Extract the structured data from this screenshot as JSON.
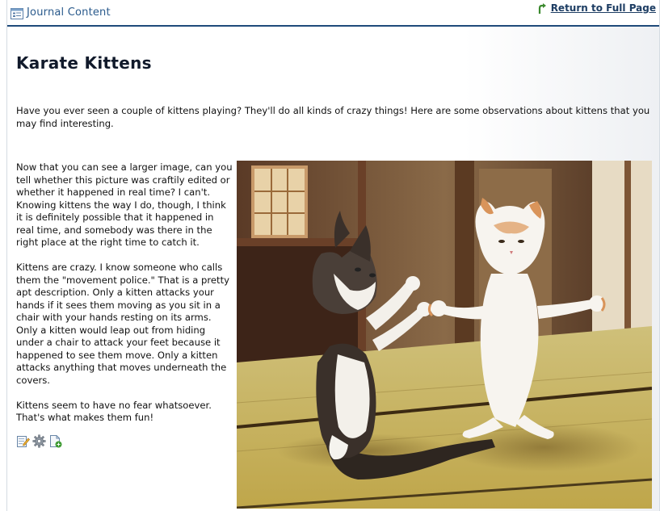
{
  "portlet": {
    "title": "Journal Content",
    "return_link": "Return to Full Page"
  },
  "article": {
    "title": "Karate Kittens",
    "intro": "Have you ever seen a couple of kittens playing? They'll do all kinds of crazy things! Here are some observations about kittens that you may find interesting.",
    "paragraphs": [
      "Now that you can see a larger image, can you tell whether this picture was craftily edited or whether it happened in real time? I can't. Knowing kittens the way I do, though, I think it is definitely possible that it happened in real time, and somebody was there in the right place at the right time to catch it.",
      "Kittens are crazy. I know someone who calls them the \"movement police.\" That is a pretty apt description. Only a kitten attacks your hands if it sees them moving as you sit in a chair with your hands resting on its arms. Only a kitten would leap out from hiding under a chair to attack your feet because it happened to see them move. Only a kitten attacks anything that moves underneath the covers.",
      "Kittens seem to have no fear whatsoever. That's what makes them fun!"
    ]
  },
  "actions": [
    {
      "icon": "edit-icon"
    },
    {
      "icon": "gear-icon"
    },
    {
      "icon": "add-page-icon"
    }
  ],
  "colors": {
    "title_bar_border": "#1f4a7a",
    "link": "#1d3d63",
    "portlet_title": "#2a5a8c"
  }
}
